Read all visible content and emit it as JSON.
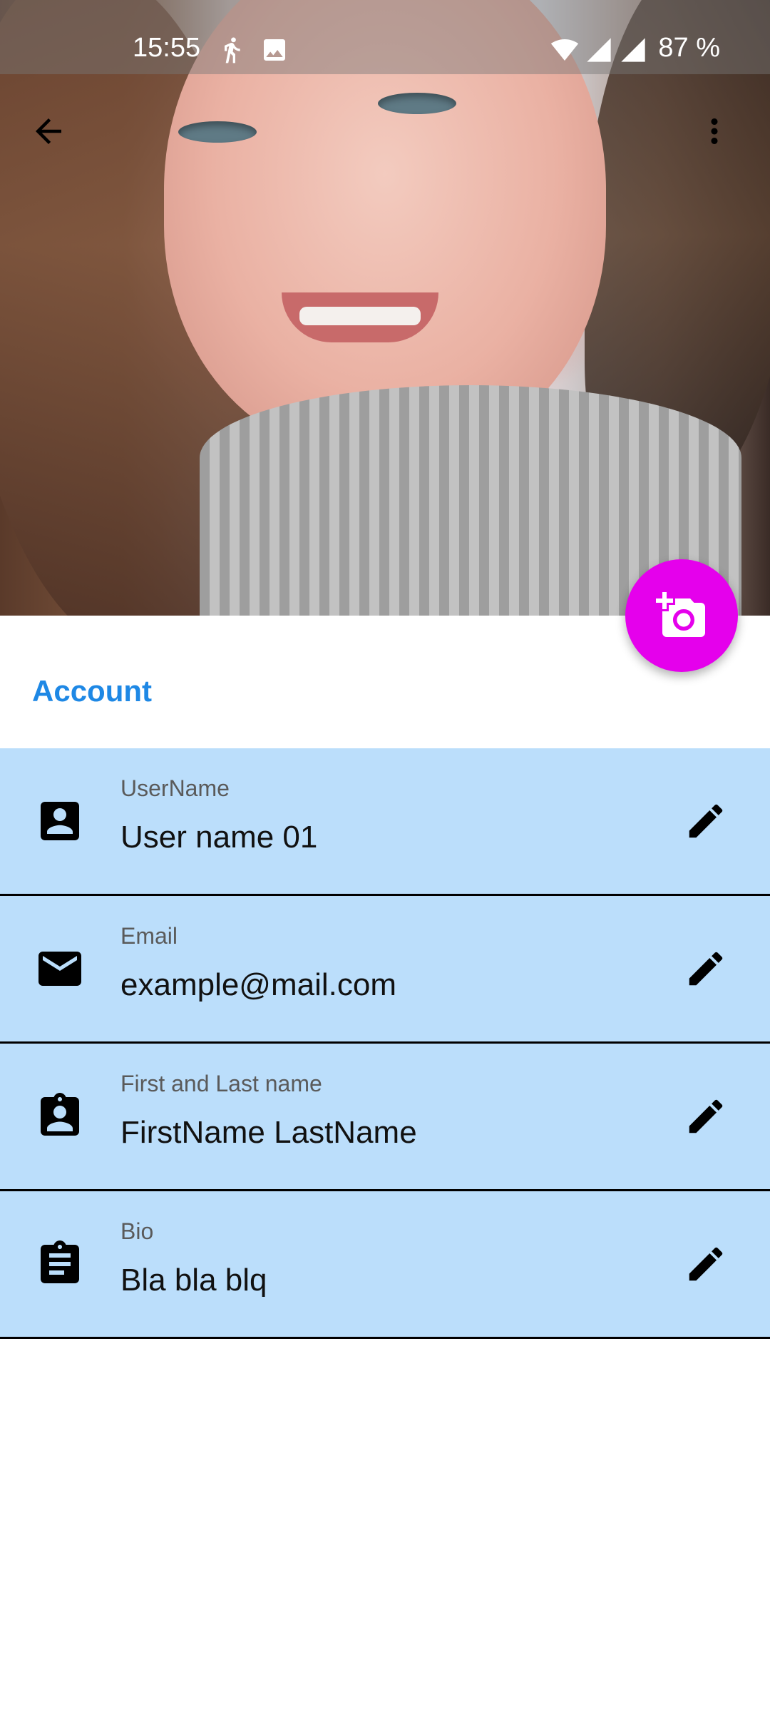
{
  "status_bar": {
    "time": "15:55",
    "battery": "87 %"
  },
  "app_bar": {
    "back_icon": "arrow-back-icon",
    "menu_icon": "more-vert-icon"
  },
  "fab": {
    "icon": "add-a-photo-icon",
    "color": "#e500ec"
  },
  "section": {
    "title": "Account",
    "title_color": "#1e88e5"
  },
  "fields": [
    {
      "icon": "account-box-icon",
      "label": "UserName",
      "value": "User name 01",
      "edit_icon": "edit-icon"
    },
    {
      "icon": "mail-icon",
      "label": "Email",
      "value": "example@mail.com",
      "edit_icon": "edit-icon"
    },
    {
      "icon": "assignment-ind-icon",
      "label": "First and Last name",
      "value": "FirstName LastName",
      "edit_icon": "edit-icon"
    },
    {
      "icon": "assignment-icon",
      "label": "Bio",
      "value": "Bla bla blq",
      "edit_icon": "edit-icon"
    }
  ],
  "row_background": "#bbdefb"
}
